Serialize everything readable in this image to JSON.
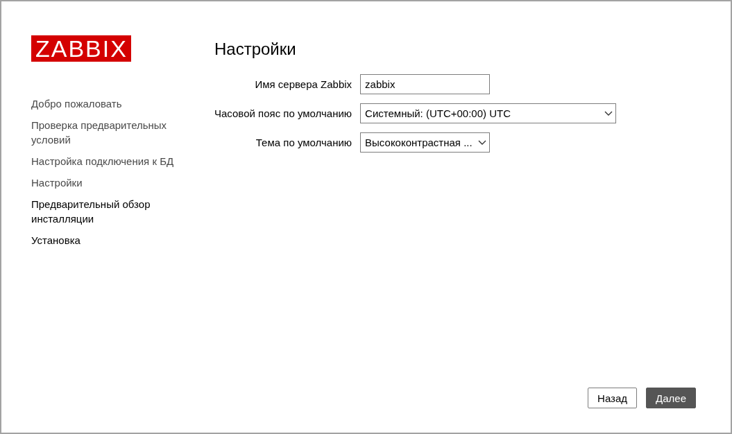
{
  "logo": {
    "text": "ZABBIX"
  },
  "steps": [
    {
      "label": "Добро пожаловать",
      "completed": true
    },
    {
      "label": "Проверка предварительных условий",
      "completed": true
    },
    {
      "label": "Настройка подключения к БД",
      "completed": true
    },
    {
      "label": "Настройки",
      "completed": true
    },
    {
      "label": "Предварительный обзор инсталляции",
      "completed": false
    },
    {
      "label": "Установка",
      "completed": false
    }
  ],
  "page_title": "Настройки",
  "form": {
    "fields": [
      {
        "kind": "text",
        "label": "Имя сервера Zabbix",
        "value": "zabbix"
      },
      {
        "kind": "select",
        "label": "Часовой пояс по умолчанию",
        "value": "Системный: (UTC+00:00) UTC"
      },
      {
        "kind": "select",
        "label": "Тема по умолчанию",
        "value": "Высококонтрастная ..."
      }
    ]
  },
  "buttons": [
    {
      "label": "Назад",
      "kind": "secondary"
    },
    {
      "label": "Далее",
      "kind": "primary"
    }
  ]
}
